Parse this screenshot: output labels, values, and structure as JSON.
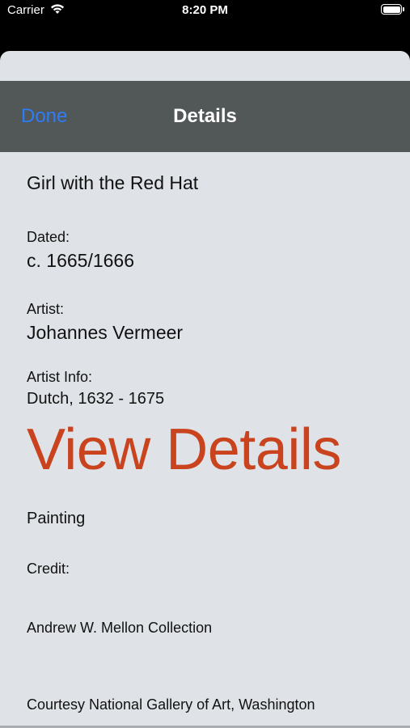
{
  "status_bar": {
    "carrier": "Carrier",
    "time": "8:20 PM",
    "wifi_icon": "wifi-icon",
    "battery_icon": "battery-icon"
  },
  "nav": {
    "done_label": "Done",
    "title": "Details"
  },
  "artwork": {
    "title": "Girl with the Red Hat",
    "dated_label": "Dated:",
    "dated_value": "c. 1665/1666",
    "artist_label": "Artist:",
    "artist_value": "Johannes Vermeer",
    "artist_info_label": "Artist Info:",
    "artist_info_value": "Dutch, 1632 - 1675",
    "view_details_label": "View Details",
    "medium": "Painting",
    "credit_label": "Credit:",
    "credit_value": "Andrew W. Mellon Collection",
    "courtesy": "Courtesy National Gallery of Art, Washington"
  },
  "colors": {
    "nav_background": "#525758",
    "done_link": "#2e7cf6",
    "view_details": "#c8431e",
    "sheet_background": "#dfe3e7"
  }
}
